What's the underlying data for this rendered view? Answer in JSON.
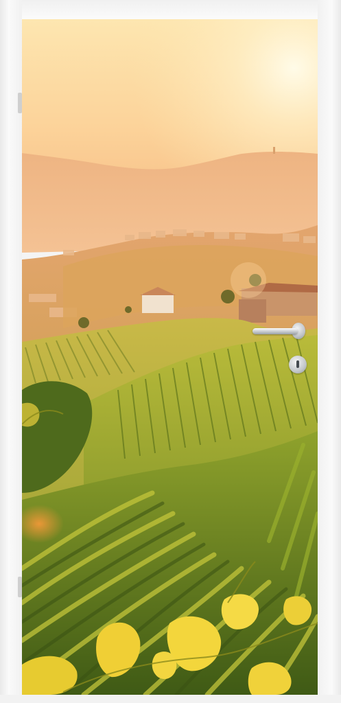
{
  "scene": {
    "subject": "door-mural",
    "palette": {
      "sky_top": "#fde8b6",
      "sky_sun": "#fff6d8",
      "haze": "#f6c089",
      "far_hills": "#eab07c",
      "mid_hills": "#e0a16a",
      "vineyard_light": "#c9c245",
      "vineyard_mid": "#8fa12b",
      "vineyard_dark": "#4f6b1a",
      "leaf_yellow": "#f2d33a",
      "frame": "#f4f4f4",
      "hardware": "#c3c7cb"
    }
  },
  "hardware": {
    "handle_icon": "lever-handle-icon",
    "lock_icon": "keyhole-icon"
  }
}
